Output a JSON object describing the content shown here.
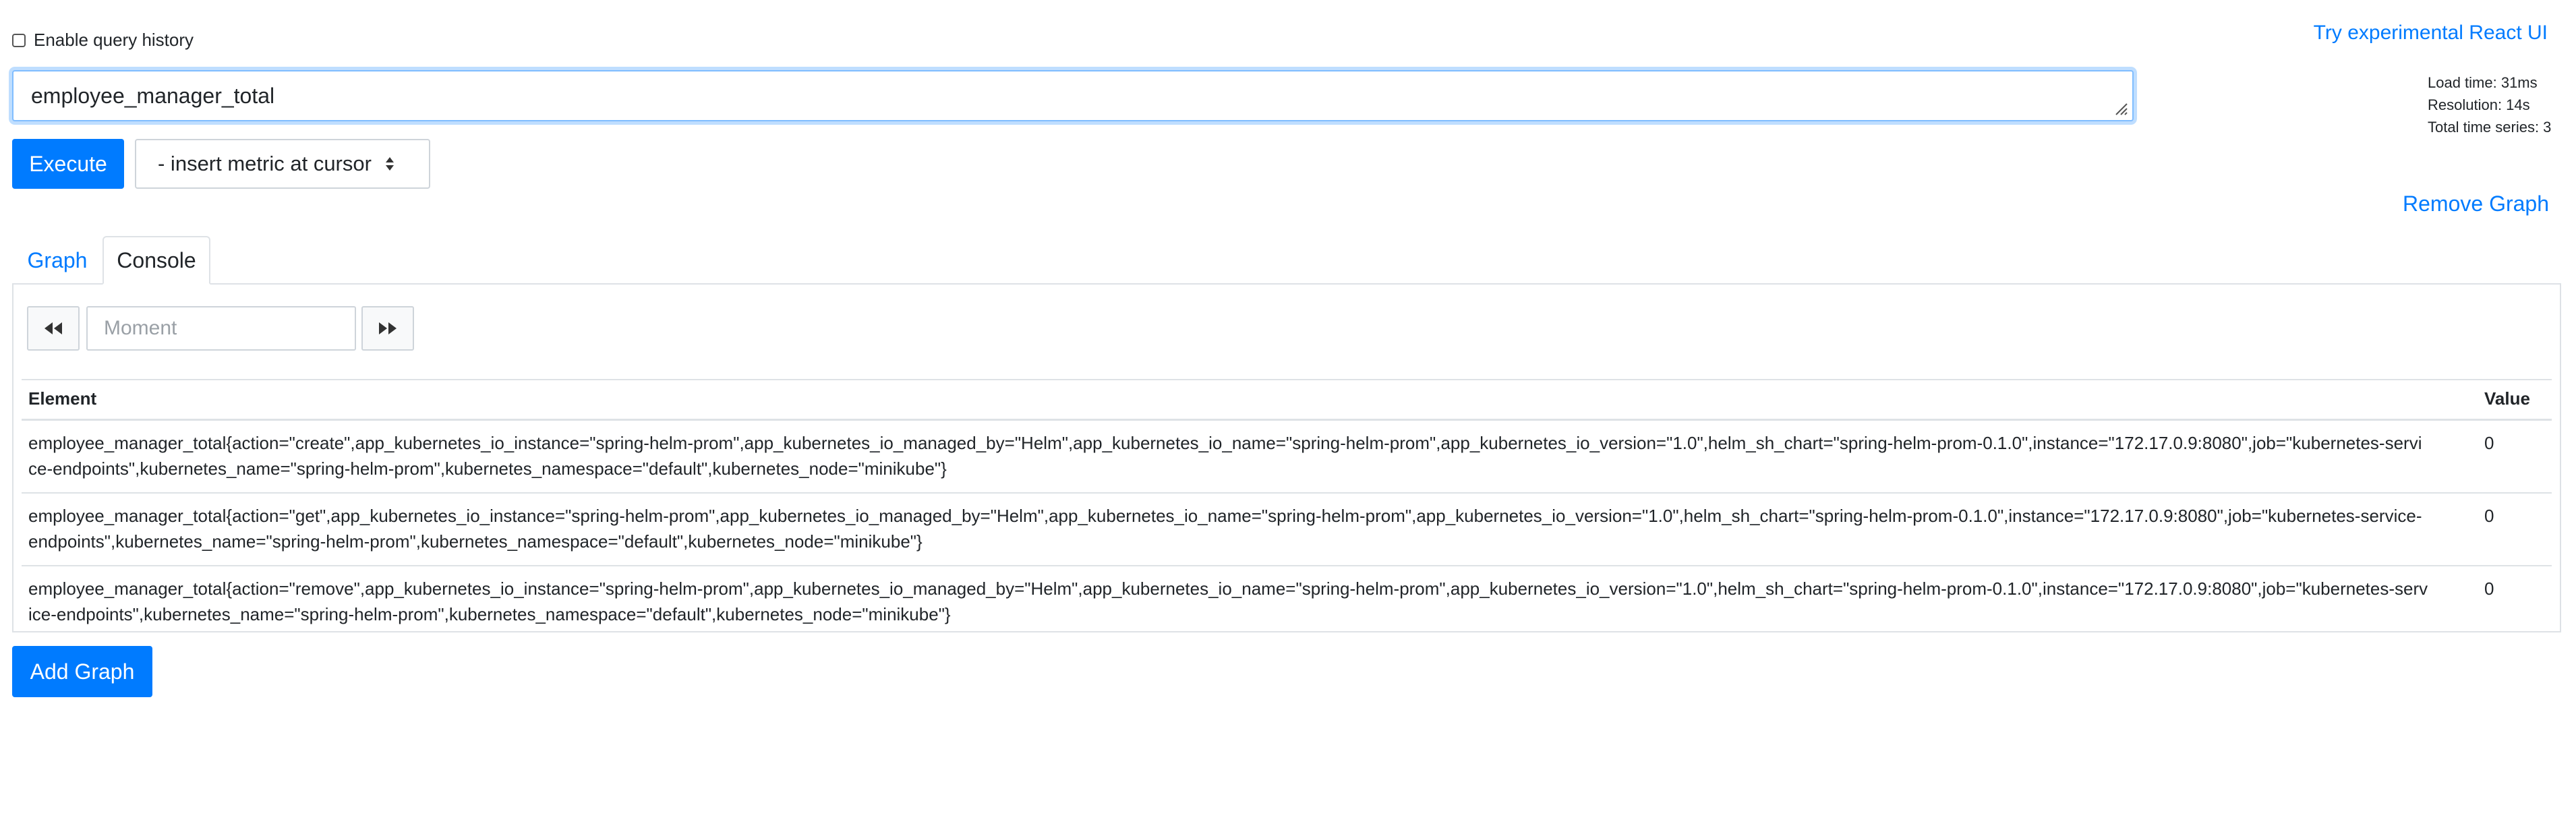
{
  "header": {
    "enable_history_label": "Enable query history",
    "react_link": "Try experimental React UI"
  },
  "query": {
    "expression": "employee_manager_total"
  },
  "stats": {
    "load_time": "Load time: 31ms",
    "resolution": "Resolution: 14s",
    "total_series": "Total time series: 3"
  },
  "toolbar": {
    "execute_label": "Execute",
    "metric_select": "- insert metric at cursor"
  },
  "graph_controls": {
    "remove_label": "Remove Graph",
    "add_label": "Add Graph"
  },
  "tabs": [
    {
      "label": "Graph",
      "active": false
    },
    {
      "label": "Console",
      "active": true
    }
  ],
  "console": {
    "moment_placeholder": "Moment",
    "columns": [
      "Element",
      "Value"
    ],
    "rows": [
      {
        "element": "employee_manager_total{action=\"create\",app_kubernetes_io_instance=\"spring-helm-prom\",app_kubernetes_io_managed_by=\"Helm\",app_kubernetes_io_name=\"spring-helm-prom\",app_kubernetes_io_version=\"1.0\",helm_sh_chart=\"spring-helm-prom-0.1.0\",instance=\"172.17.0.9:8080\",job=\"kubernetes-service-endpoints\",kubernetes_name=\"spring-helm-prom\",kubernetes_namespace=\"default\",kubernetes_node=\"minikube\"}",
        "value": "0"
      },
      {
        "element": "employee_manager_total{action=\"get\",app_kubernetes_io_instance=\"spring-helm-prom\",app_kubernetes_io_managed_by=\"Helm\",app_kubernetes_io_name=\"spring-helm-prom\",app_kubernetes_io_version=\"1.0\",helm_sh_chart=\"spring-helm-prom-0.1.0\",instance=\"172.17.0.9:8080\",job=\"kubernetes-service-endpoints\",kubernetes_name=\"spring-helm-prom\",kubernetes_namespace=\"default\",kubernetes_node=\"minikube\"}",
        "value": "0"
      },
      {
        "element": "employee_manager_total{action=\"remove\",app_kubernetes_io_instance=\"spring-helm-prom\",app_kubernetes_io_managed_by=\"Helm\",app_kubernetes_io_name=\"spring-helm-prom\",app_kubernetes_io_version=\"1.0\",helm_sh_chart=\"spring-helm-prom-0.1.0\",instance=\"172.17.0.9:8080\",job=\"kubernetes-service-endpoints\",kubernetes_name=\"spring-helm-prom\",kubernetes_namespace=\"default\",kubernetes_node=\"minikube\"}",
        "value": "0"
      }
    ]
  },
  "colors": {
    "accent": "#007bff",
    "border": "#dee2e6"
  },
  "icons": {
    "prev": "fast-backward-icon",
    "next": "fast-forward-icon"
  }
}
